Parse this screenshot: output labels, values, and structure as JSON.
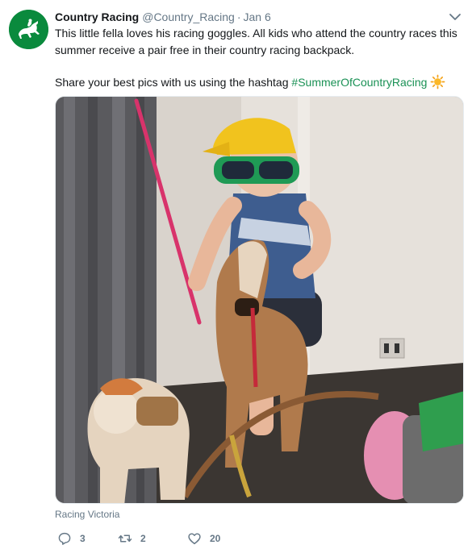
{
  "tweet": {
    "display_name": "Country Racing",
    "handle": "@Country_Racing",
    "separator": "·",
    "date": "Jan 6",
    "text_line1": "This little fella loves his racing goggles. All kids who attend the country races this",
    "text_line2": "summer receive a pair free in their country racing backpack.",
    "text_line3": "Share your best pics with us using the hashtag",
    "hashtag": "#SummerOfCountryRacing",
    "emoji": "sun-icon",
    "media_source": "Racing Victoria",
    "counts": {
      "replies": "3",
      "retweets": "2",
      "likes": "20"
    },
    "colors": {
      "avatar_bg": "#0a8a3d",
      "hashtag": "#1a9155",
      "meta": "#657786"
    }
  }
}
